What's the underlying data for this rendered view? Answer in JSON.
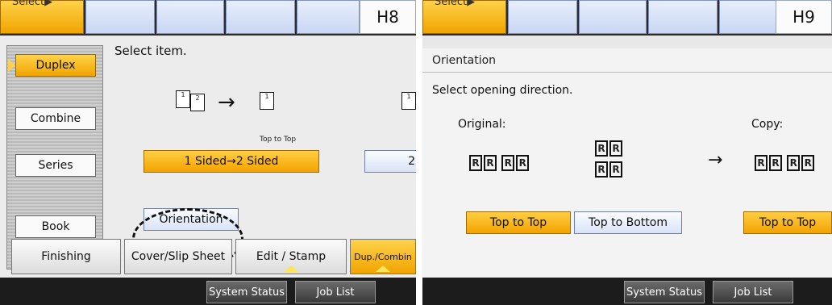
{
  "left": {
    "tabs": {
      "selected_label": "Select▶",
      "mode_id": "H8"
    },
    "side_menu": [
      "Duplex",
      "Combine",
      "Series",
      "Book"
    ],
    "instruction": "Select item.",
    "duplex_option": {
      "label": "1 Sided→2 Sided",
      "sublabel": "Top to Top"
    },
    "right_option_label": "2",
    "orientation_button": "Orientation",
    "function_tabs": [
      "Finishing",
      "Cover/Slip Sheet",
      "Edit / Stamp",
      "Dup./Combin"
    ],
    "status_buttons": [
      "System Status",
      "Job List"
    ]
  },
  "right": {
    "tabs": {
      "selected_label": "Select▶",
      "mode_id": "H9"
    },
    "title": "Orientation",
    "instruction": "Select opening direction.",
    "original_label": "Original:",
    "copy_label": "Copy:",
    "original_buttons": [
      "Top to Top",
      "Top to Bottom"
    ],
    "copy_button": "Top to Top",
    "status_buttons": [
      "System Status",
      "Job List"
    ],
    "icon_letter": "R"
  },
  "colors": {
    "accent_yellow": "#f0a400",
    "button_blue": "#d9e3f7",
    "bar_dark": "#1c1c1c"
  }
}
